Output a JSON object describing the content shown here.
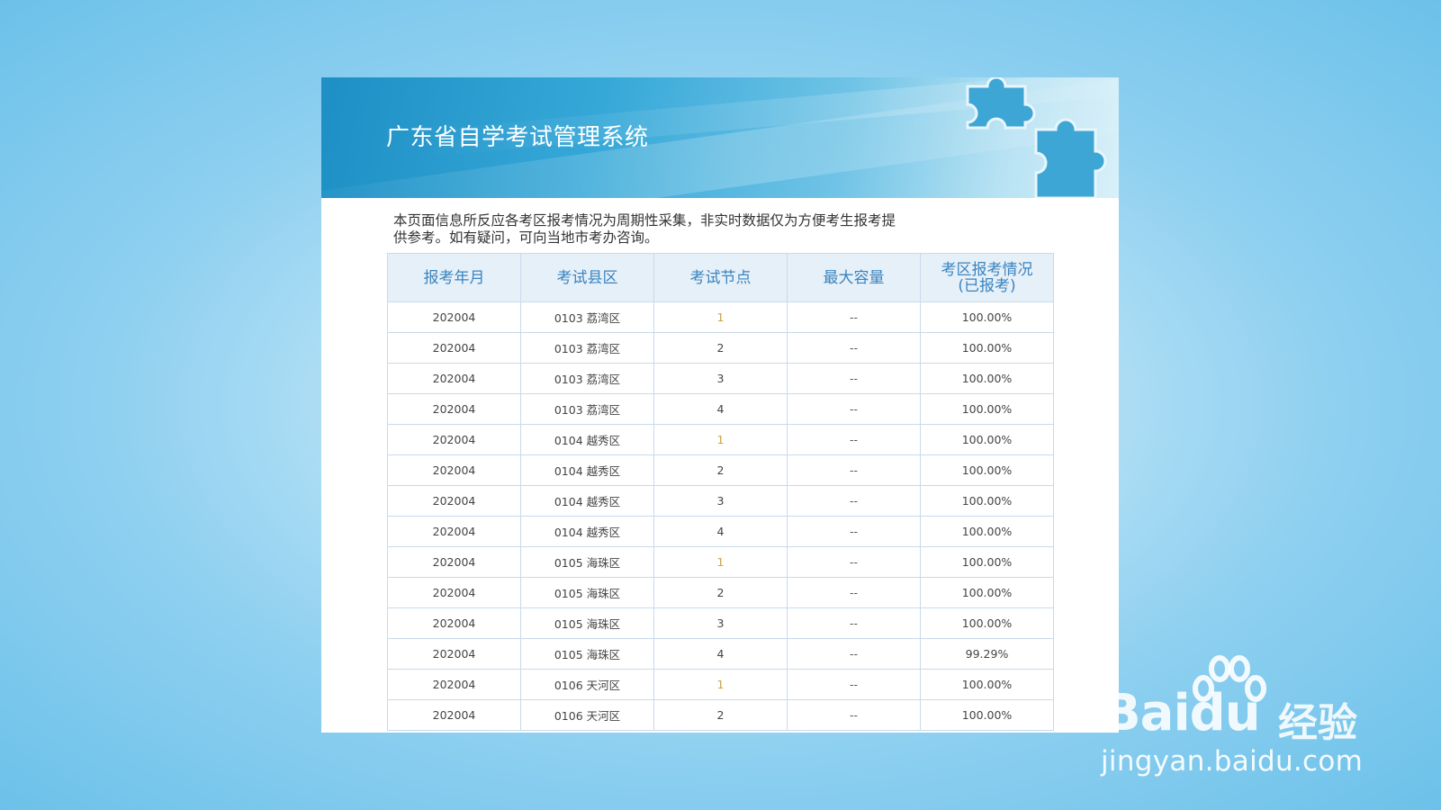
{
  "banner": {
    "title": "广东省自学考试管理系统"
  },
  "notice": {
    "text": "本页面信息所反应各考区报考情况为周期性采集，非实时数据仅为方便考生报考提供参考。如有疑问，可向当地市考办咨询。"
  },
  "table": {
    "headers": {
      "month": "报考年月",
      "district": "考试县区",
      "node": "考试节点",
      "capacity": "最大容量",
      "status_line1": "考区报考情况",
      "status_line2": "(已报考)"
    },
    "rows": [
      {
        "month": "202004",
        "district": "0103 荔湾区",
        "node": "1",
        "capacity": "--",
        "status": "100.00%"
      },
      {
        "month": "202004",
        "district": "0103 荔湾区",
        "node": "2",
        "capacity": "--",
        "status": "100.00%"
      },
      {
        "month": "202004",
        "district": "0103 荔湾区",
        "node": "3",
        "capacity": "--",
        "status": "100.00%"
      },
      {
        "month": "202004",
        "district": "0103 荔湾区",
        "node": "4",
        "capacity": "--",
        "status": "100.00%"
      },
      {
        "month": "202004",
        "district": "0104 越秀区",
        "node": "1",
        "capacity": "--",
        "status": "100.00%"
      },
      {
        "month": "202004",
        "district": "0104 越秀区",
        "node": "2",
        "capacity": "--",
        "status": "100.00%"
      },
      {
        "month": "202004",
        "district": "0104 越秀区",
        "node": "3",
        "capacity": "--",
        "status": "100.00%"
      },
      {
        "month": "202004",
        "district": "0104 越秀区",
        "node": "4",
        "capacity": "--",
        "status": "100.00%"
      },
      {
        "month": "202004",
        "district": "0105 海珠区",
        "node": "1",
        "capacity": "--",
        "status": "100.00%"
      },
      {
        "month": "202004",
        "district": "0105 海珠区",
        "node": "2",
        "capacity": "--",
        "status": "100.00%"
      },
      {
        "month": "202004",
        "district": "0105 海珠区",
        "node": "3",
        "capacity": "--",
        "status": "100.00%"
      },
      {
        "month": "202004",
        "district": "0105 海珠区",
        "node": "4",
        "capacity": "--",
        "status": "99.29%"
      },
      {
        "month": "202004",
        "district": "0106 天河区",
        "node": "1",
        "capacity": "--",
        "status": "100.00%"
      },
      {
        "month": "202004",
        "district": "0106 天河区",
        "node": "2",
        "capacity": "--",
        "status": "100.00%"
      }
    ]
  },
  "watermark": {
    "brand": "Baidu",
    "brand_cn": "经验",
    "url": "jingyan.baidu.com"
  },
  "icons": {
    "banner_decoration": "puzzle-piece-icon",
    "watermark_logo": "baidu-paw-icon"
  },
  "colors": {
    "page_bg": "#8fd0f0",
    "banner_blue": "#1d8fc4",
    "header_text": "#3a84bf",
    "header_bg": "#e6f0f9",
    "grid": "#c9daea"
  }
}
